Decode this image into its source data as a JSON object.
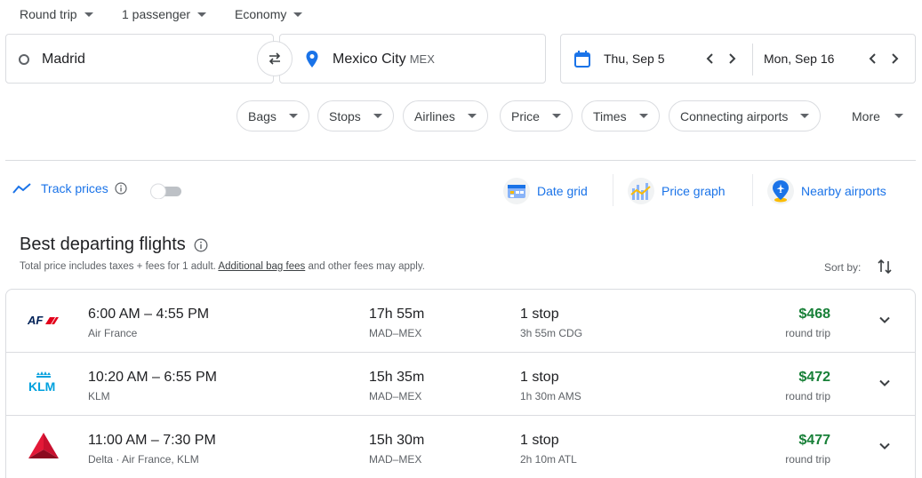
{
  "top": {
    "trip_type": "Round trip",
    "passengers": "1 passenger",
    "cabin": "Economy"
  },
  "search": {
    "origin": "Madrid",
    "destination": "Mexico City",
    "destination_code": "MEX",
    "depart_date": "Thu, Sep 5",
    "return_date": "Mon, Sep 16"
  },
  "filters": {
    "chips": [
      "Bags",
      "Stops",
      "Airlines",
      "Price",
      "Times",
      "Connecting airports"
    ],
    "more": "More"
  },
  "tools": {
    "track_prices": "Track prices",
    "date_grid": "Date grid",
    "price_graph": "Price graph",
    "nearby_airports": "Nearby airports"
  },
  "results": {
    "title": "Best departing flights",
    "subtitle_prefix": "Total price includes taxes + fees for 1 adult.",
    "subtitle_link": "Additional bag fees",
    "subtitle_suffix": "and other fees may apply.",
    "sort_by": "Sort by:",
    "flights": [
      {
        "times": "6:00 AM – 4:55 PM",
        "airline": "Air France",
        "duration": "17h 55m",
        "route": "MAD–MEX",
        "stops": "1 stop",
        "layover": "3h 55m CDG",
        "price": "$468",
        "price_type": "round trip",
        "logo": "air-france-logo"
      },
      {
        "times": "10:20 AM – 6:55 PM",
        "airline": "KLM",
        "duration": "15h 35m",
        "route": "MAD–MEX",
        "stops": "1 stop",
        "layover": "1h 30m AMS",
        "price": "$472",
        "price_type": "round trip",
        "logo": "klm-logo"
      },
      {
        "times": "11:00 AM – 7:30 PM",
        "airline": "Delta · Air France, KLM",
        "duration": "15h 30m",
        "route": "MAD–MEX",
        "stops": "1 stop",
        "layover": "2h 10m ATL",
        "price": "$477",
        "price_type": "round trip",
        "logo": "delta-logo"
      }
    ]
  },
  "colors": {
    "accent": "#1a73e8",
    "price": "#188038",
    "air_france_blue": "#002157",
    "air_france_red": "#e3001b",
    "klm_blue": "#00a1de",
    "delta_red": "#c8102e"
  },
  "logos": {
    "air_france": "AF",
    "klm": "KLM"
  }
}
